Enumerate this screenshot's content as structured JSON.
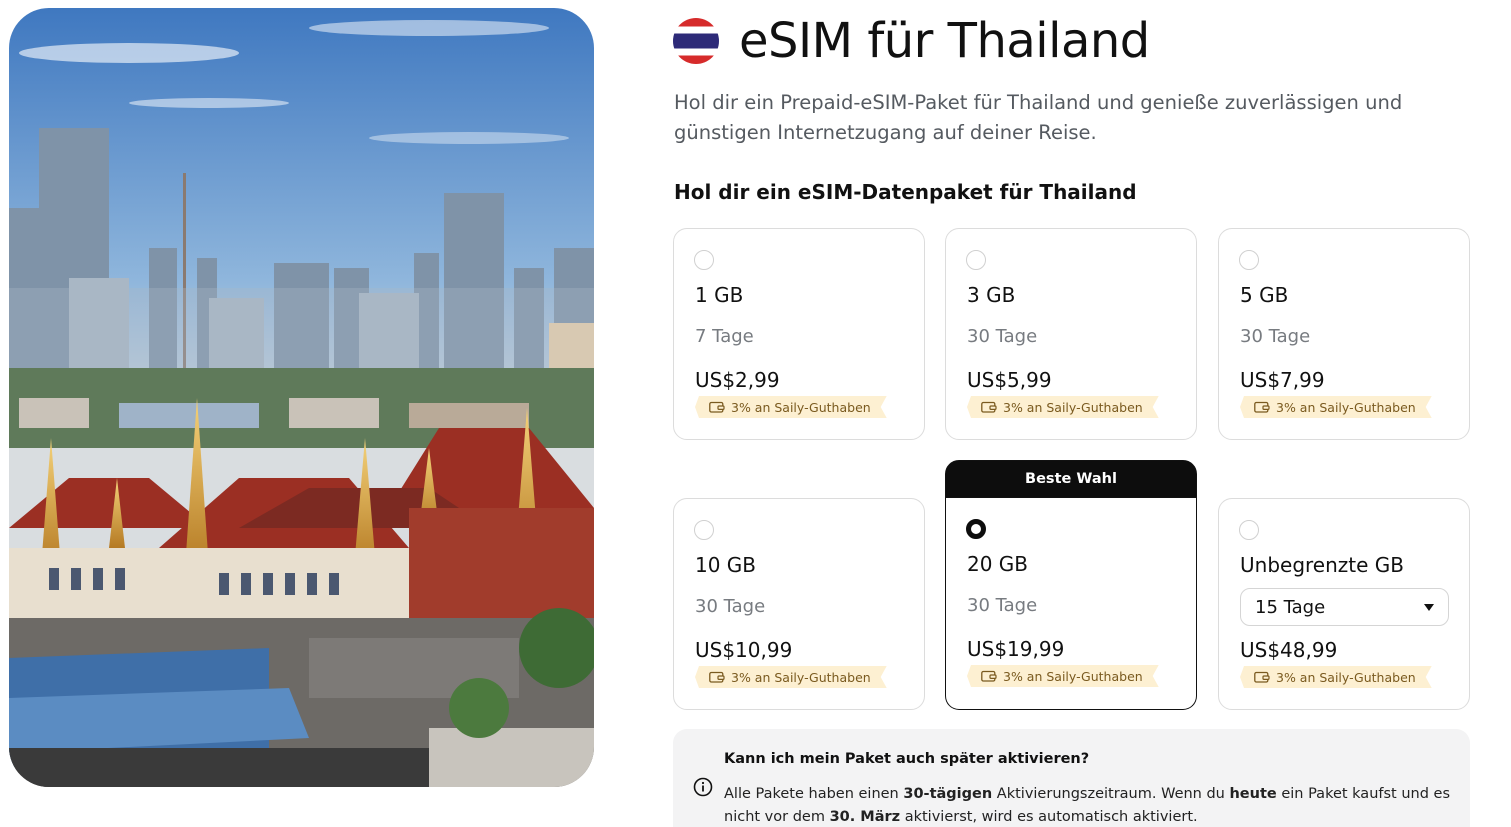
{
  "hero": {
    "image_alt": "Bangkok skyline with Grand Palace",
    "icon": "photo"
  },
  "header": {
    "flag_icon": "thailand-flag-icon",
    "title": "eSIM für Thailand",
    "subtitle": "Hol dir ein Prepaid-eSIM-Paket für Thailand und genieße zuverlässigen und günstigen Internetzugang auf deiner Reise."
  },
  "section_title": "Hol dir ein eSIM-Datenpaket für Thailand",
  "plans": [
    {
      "data": "1 GB",
      "duration": "7 Tage",
      "price": "US$2,99",
      "credit": "3% an Saily-Guthaben",
      "selected": false
    },
    {
      "data": "3 GB",
      "duration": "30 Tage",
      "price": "US$5,99",
      "credit": "3% an Saily-Guthaben",
      "selected": false
    },
    {
      "data": "5 GB",
      "duration": "30 Tage",
      "price": "US$7,99",
      "credit": "3% an Saily-Guthaben",
      "selected": false
    },
    {
      "data": "10 GB",
      "duration": "30 Tage",
      "price": "US$10,99",
      "credit": "3% an Saily-Guthaben",
      "selected": false
    },
    {
      "data": "20 GB",
      "duration": "30 Tage",
      "price": "US$19,99",
      "credit": "3% an Saily-Guthaben",
      "selected": true,
      "badge": "Beste Wahl"
    },
    {
      "data": "Unbegrenzte GB",
      "duration": "15 Tage",
      "price": "US$48,99",
      "credit": "3% an Saily-Guthaben",
      "selected": false,
      "duration_is_select": true
    }
  ],
  "faq": {
    "question": "Kann ich mein Paket auch später aktivieren?",
    "answer_parts": [
      "Alle Pakete haben einen ",
      "30-tägigen",
      " Aktivierungszeitraum. Wenn du ",
      "heute",
      " ein Paket kaufst und es nicht vor dem ",
      "30. März",
      " aktivierst, wird es automatisch aktiviert."
    ]
  },
  "colors": {
    "accent": "#0d0d0d",
    "credit_bg": "#fdf0d2",
    "credit_text": "#7a5a1f",
    "muted": "#777b80"
  }
}
